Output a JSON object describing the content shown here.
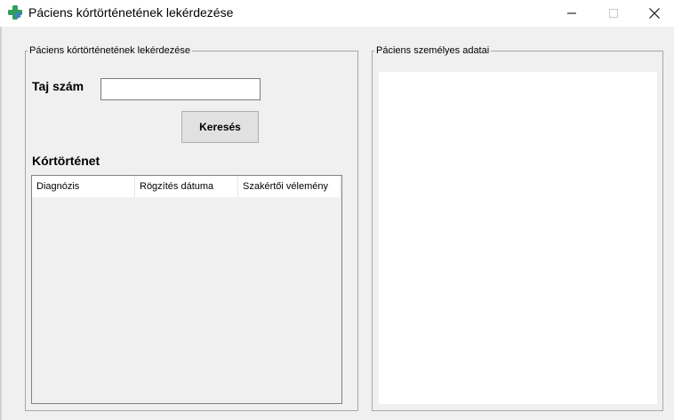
{
  "window": {
    "title": "Páciens kórtörténetének lekérdezése"
  },
  "search_group": {
    "title": "Páciens kórtörténetének lekérdezése",
    "taj_label": "Taj szám",
    "taj_value": "",
    "search_button": "Keresés",
    "history_label": "Kórtörténet",
    "columns": [
      "Diagnózis",
      "Rögzítés dátuma",
      "Szakértői vélemény"
    ]
  },
  "personal_group": {
    "title": "Páciens személyes adatai"
  },
  "icons": {
    "app": "medical-cross-icon",
    "minimize": "minimize-icon",
    "maximize": "maximize-icon",
    "close": "close-icon"
  },
  "colors": {
    "app_icon_green": "#2e9e5b",
    "app_icon_blue": "#3f7fbf"
  }
}
